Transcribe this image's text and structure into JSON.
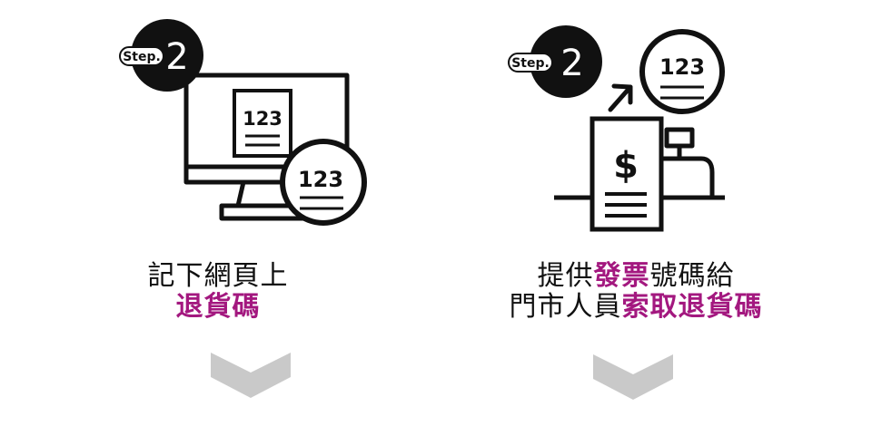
{
  "colors": {
    "highlight": "#a3187f",
    "line": "#111111",
    "chevron": "#c9c9c9"
  },
  "steps": [
    {
      "badge": {
        "label": "Step.",
        "number": "2"
      },
      "illustration": {
        "icons": [
          "computer-monitor-icon",
          "receipt-icon",
          "magnifier-icon"
        ],
        "code": "123"
      },
      "caption": {
        "line1": "記下網頁上",
        "line2_highlight": "退貨碼"
      }
    },
    {
      "badge": {
        "label": "Step.",
        "number": "2"
      },
      "illustration": {
        "icons": [
          "invoice-dollar-icon",
          "cash-register-icon",
          "arrow-up-right-icon",
          "magnifier-icon"
        ],
        "code": "123",
        "symbol": "$"
      },
      "caption": {
        "line1_prefix": "提供",
        "line1_highlight": "發票",
        "line1_suffix": "號碼給",
        "line2_prefix": "門市人員",
        "line2_highlight": "索取退貨碼"
      }
    }
  ]
}
